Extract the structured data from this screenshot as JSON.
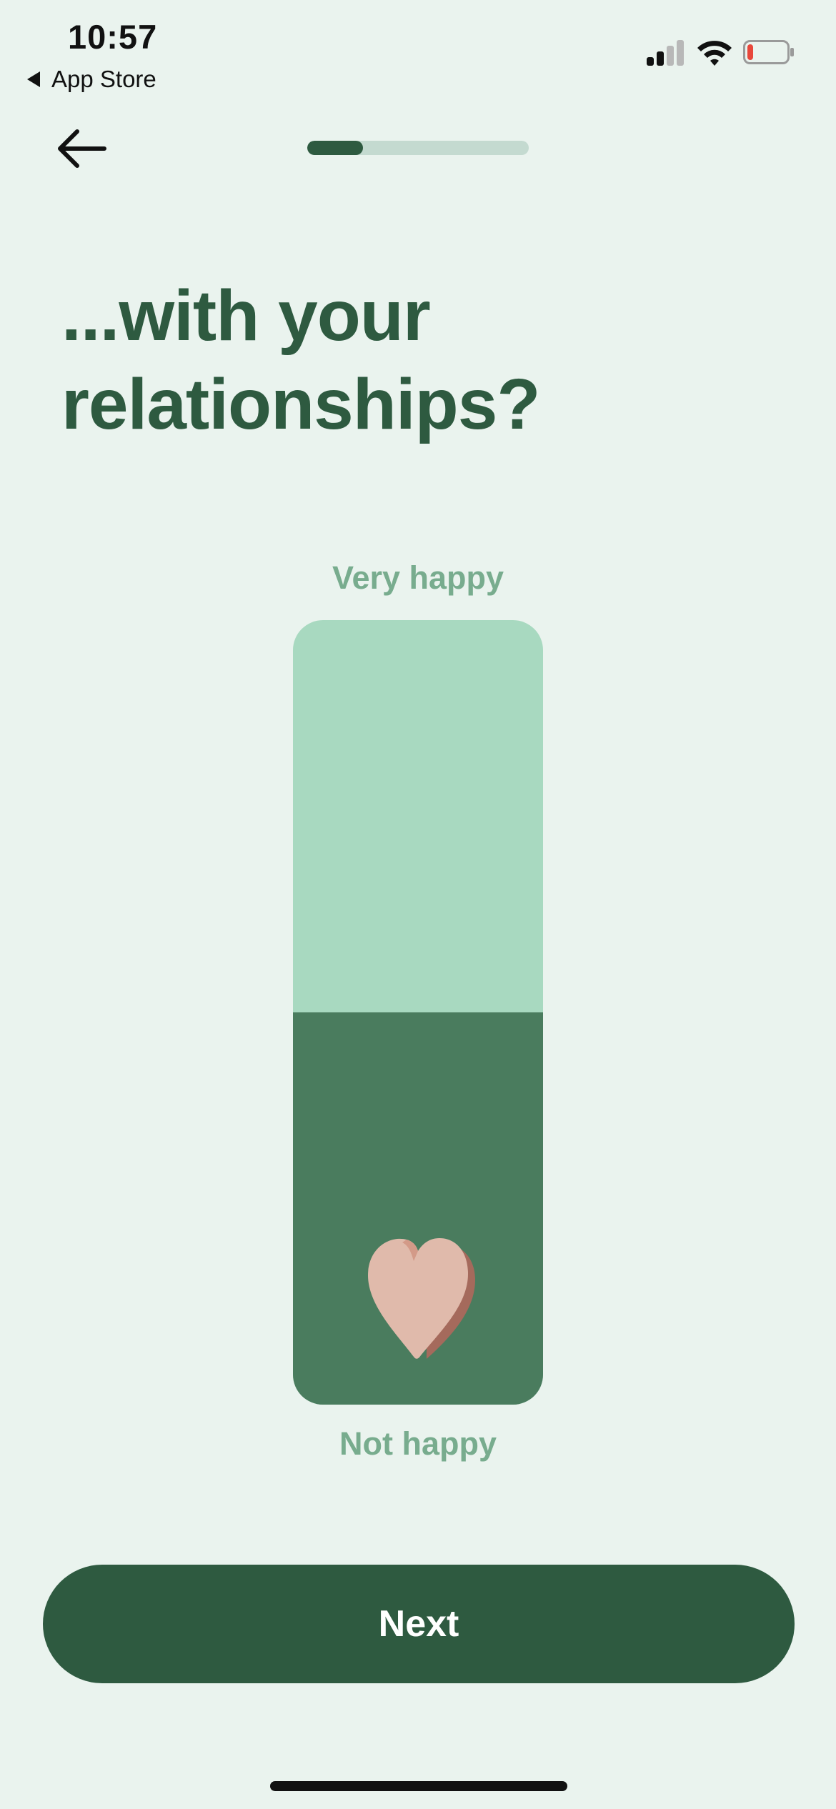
{
  "status_bar": {
    "time": "10:57",
    "back_app_label": "App Store",
    "signal_bars_active": 2,
    "battery_level_fraction": 0.15,
    "battery_color": "#E8473B"
  },
  "nav": {
    "back_icon": "arrow-left-icon",
    "progress_fraction": 0.25
  },
  "question": {
    "title_line1": "...with your",
    "title_line2": "relationships?"
  },
  "scale": {
    "top_label": "Very happy",
    "bottom_label": "Not happy",
    "value_fraction": 0.5,
    "thumb_icon": "heart-icon"
  },
  "footer": {
    "next_label": "Next"
  },
  "colors": {
    "background": "#EAF3EE",
    "primary": "#2E5A40",
    "slider_track": "#A8D9C0",
    "slider_fill": "#4A7C5E",
    "label": "#78AC8E",
    "heart": "#E0BAAB"
  }
}
